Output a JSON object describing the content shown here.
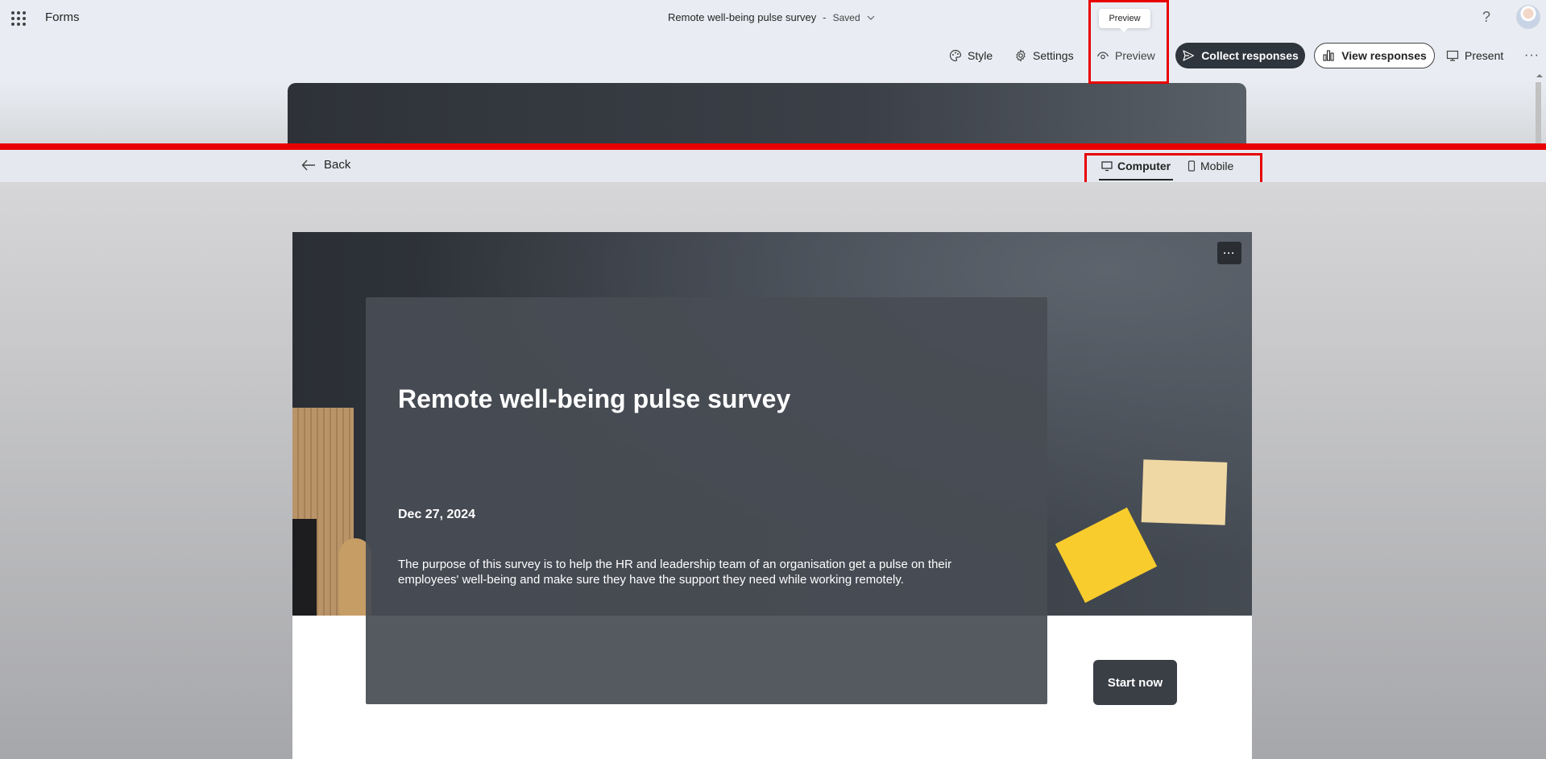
{
  "app": {
    "name": "Forms"
  },
  "header": {
    "title": "Remote well-being pulse survey",
    "separator": "-",
    "save_status": "Saved",
    "help_label": "?"
  },
  "tooltip": {
    "text": "Preview"
  },
  "toolbar": {
    "style_label": "Style",
    "settings_label": "Settings",
    "preview_label": "Preview",
    "collect_label": "Collect responses",
    "view_label": "View responses",
    "present_label": "Present",
    "more_label": "···"
  },
  "preview_bar": {
    "back_label": "Back",
    "tabs": [
      {
        "label": "Computer",
        "selected": true
      },
      {
        "label": "Mobile",
        "selected": false
      }
    ]
  },
  "form": {
    "more_label": "···",
    "title": "Remote well-being pulse survey",
    "date": "Dec 27, 2024",
    "description": "The purpose of this survey is to help the HR and leadership team of an organisation get a pulse on their employees' well-being and make sure they have the support they need while working remotely.",
    "start_label": "Start now"
  },
  "colors": {
    "accent_dark": "#2f353d",
    "highlight": "#e80000",
    "chrome_bg": "#e9edf3"
  }
}
